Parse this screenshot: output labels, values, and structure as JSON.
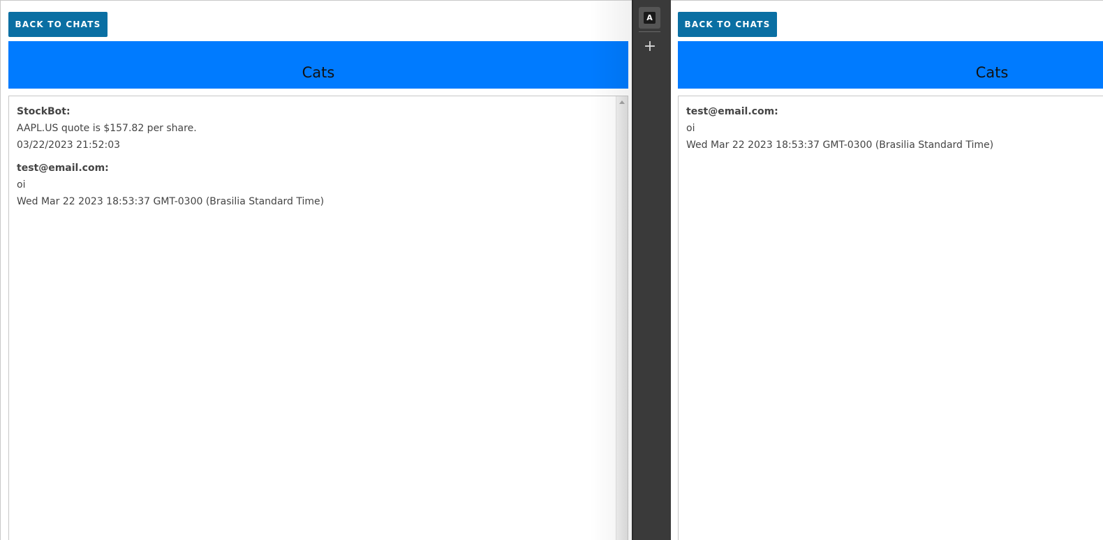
{
  "left_pane": {
    "back_button_label": "BACK TO CHATS",
    "chat_title": "Cats",
    "messages": [
      {
        "author": "StockBot:",
        "text": "AAPL.US quote is $157.82 per share.",
        "timestamp": "03/22/2023 21:52:03"
      },
      {
        "author": "test@email.com:",
        "text": "oi",
        "timestamp": "Wed Mar 22 2023 18:53:37 GMT-0300 (Brasilia Standard Time)"
      }
    ]
  },
  "divider": {
    "tab_icon_glyph": "A",
    "add_tab_glyph": "+",
    "icons": [
      "app-logo-icon",
      "plus-icon"
    ]
  },
  "right_pane": {
    "back_button_label": "BACK TO CHATS",
    "chat_title": "Cats",
    "messages": [
      {
        "author": "test@email.com:",
        "text": "oi",
        "timestamp": "Wed Mar 22 2023 18:53:37 GMT-0300 (Brasilia Standard Time)"
      }
    ]
  },
  "colors": {
    "button_bg": "#0a6fa3",
    "header_bg": "#007bff",
    "divider_bg": "#3a3a3a"
  }
}
